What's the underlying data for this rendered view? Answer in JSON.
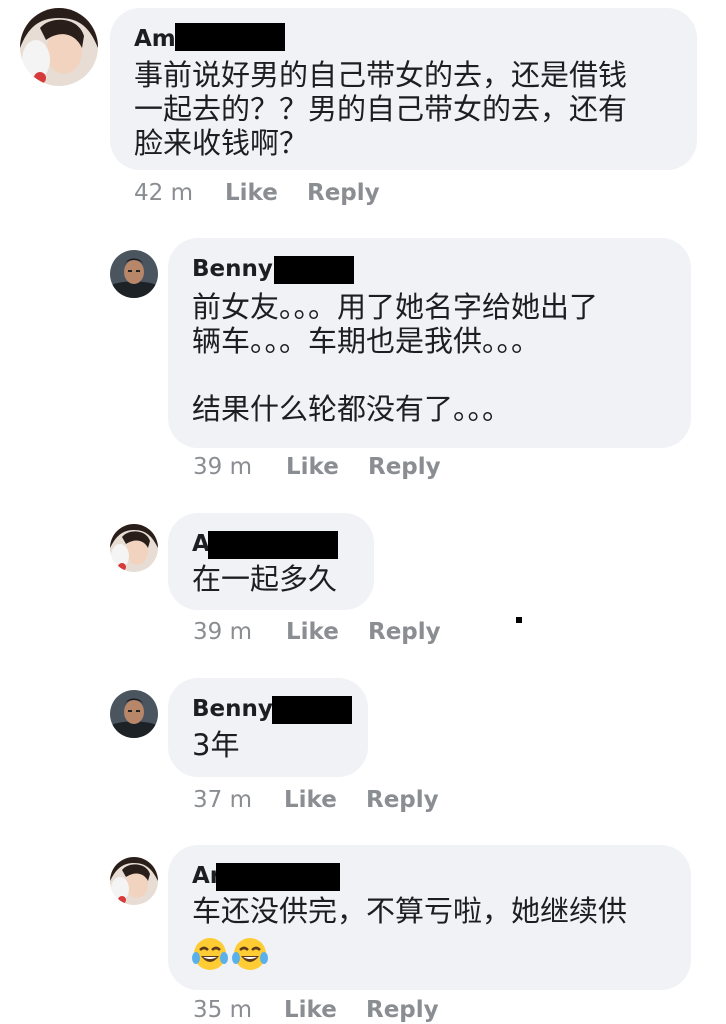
{
  "comments": [
    {
      "author": "Am",
      "text": "事前说好男的自己带女的去，还是借钱\n一起去的？？男的自己带女的去，还有\n脸来收钱啊？",
      "time": "42 m",
      "like": "Like",
      "reply": "Reply"
    },
    {
      "author": "Benny",
      "text": "前女友。。。用了她名字给她出了\n辆车。。。车期也是我供。。。\n\n结果什么轮都没有了。。。",
      "time": "39 m",
      "like": "Like",
      "reply": "Reply"
    },
    {
      "author": "A",
      "text": "在一起多久",
      "time": "39 m",
      "like": "Like",
      "reply": "Reply"
    },
    {
      "author": "Benny",
      "text": "3年",
      "time": "37 m",
      "like": "Like",
      "reply": "Reply"
    },
    {
      "author": "Ar",
      "text": "车还没供完，不算亏啦，她继续供",
      "emoji": [
        "tears-of-joy-icon",
        "tears-of-joy-icon"
      ],
      "time": "35 m",
      "like": "Like",
      "reply": "Reply"
    }
  ],
  "colors": {
    "bubble": "#f0f2f5",
    "text": "#1c1e21",
    "meta": "#8a8d91",
    "redaction": "#000000"
  }
}
